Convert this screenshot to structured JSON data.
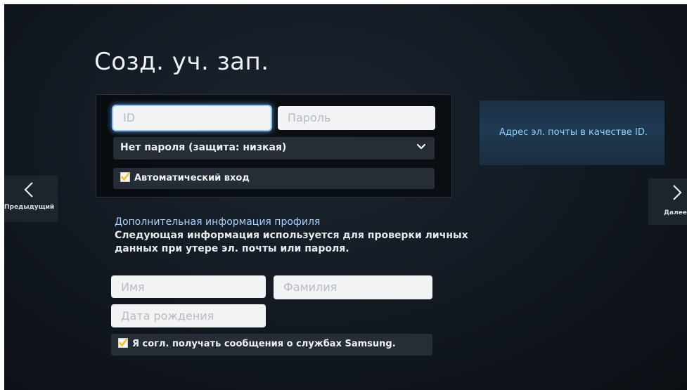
{
  "page": {
    "title": "Созд. уч. зап."
  },
  "login": {
    "id_placeholder": "ID",
    "password_placeholder": "Пароль",
    "password_mode": "Нет пароля (защита: низкая)",
    "auto_login_label": "Автоматический вход",
    "auto_login_checked": true
  },
  "profile": {
    "heading": "Дополнительная информация профиля",
    "description_line1": "Следующая информация используется для проверки личных",
    "description_line2": "данных при утере эл. почты или пароля.",
    "first_name_placeholder": "Имя",
    "last_name_placeholder": "Фамилия",
    "birthdate_placeholder": "Дата рождения",
    "consent_label": "Я согл. получать сообщения о службах Samsung.",
    "consent_checked": true
  },
  "help": {
    "hint": "Адрес эл. почты в качестве ID."
  },
  "navigation": {
    "prev_label": "Предыдущий",
    "next_label": "Далее"
  },
  "colors": {
    "accent_check": "#f2c21b",
    "focus_glow": "#4f8fd4",
    "hint_text": "#8fd0ff"
  }
}
